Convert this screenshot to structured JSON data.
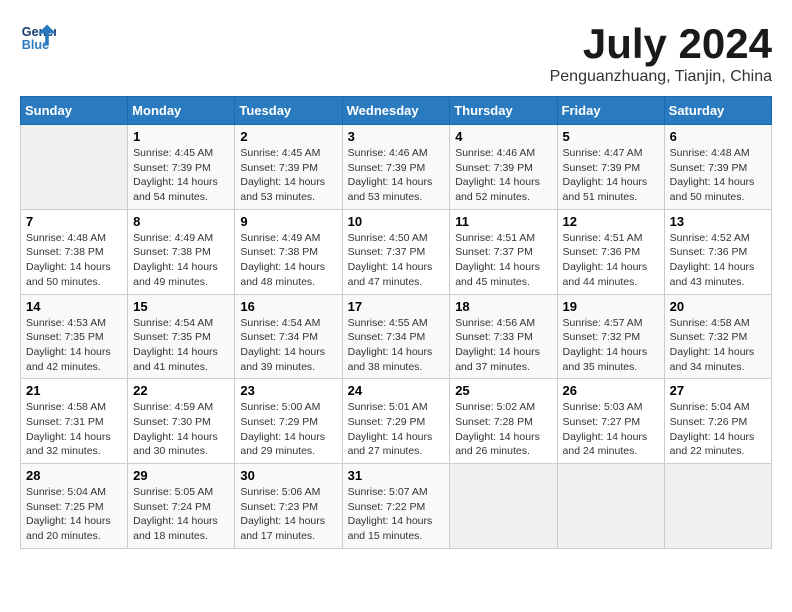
{
  "header": {
    "logo_line1": "General",
    "logo_line2": "Blue",
    "month_year": "July 2024",
    "location": "Penguanzhuang, Tianjin, China"
  },
  "weekdays": [
    "Sunday",
    "Monday",
    "Tuesday",
    "Wednesday",
    "Thursday",
    "Friday",
    "Saturday"
  ],
  "weeks": [
    [
      {
        "day": "",
        "info": ""
      },
      {
        "day": "1",
        "info": "Sunrise: 4:45 AM\nSunset: 7:39 PM\nDaylight: 14 hours\nand 54 minutes."
      },
      {
        "day": "2",
        "info": "Sunrise: 4:45 AM\nSunset: 7:39 PM\nDaylight: 14 hours\nand 53 minutes."
      },
      {
        "day": "3",
        "info": "Sunrise: 4:46 AM\nSunset: 7:39 PM\nDaylight: 14 hours\nand 53 minutes."
      },
      {
        "day": "4",
        "info": "Sunrise: 4:46 AM\nSunset: 7:39 PM\nDaylight: 14 hours\nand 52 minutes."
      },
      {
        "day": "5",
        "info": "Sunrise: 4:47 AM\nSunset: 7:39 PM\nDaylight: 14 hours\nand 51 minutes."
      },
      {
        "day": "6",
        "info": "Sunrise: 4:48 AM\nSunset: 7:39 PM\nDaylight: 14 hours\nand 50 minutes."
      }
    ],
    [
      {
        "day": "7",
        "info": "Sunrise: 4:48 AM\nSunset: 7:38 PM\nDaylight: 14 hours\nand 50 minutes."
      },
      {
        "day": "8",
        "info": "Sunrise: 4:49 AM\nSunset: 7:38 PM\nDaylight: 14 hours\nand 49 minutes."
      },
      {
        "day": "9",
        "info": "Sunrise: 4:49 AM\nSunset: 7:38 PM\nDaylight: 14 hours\nand 48 minutes."
      },
      {
        "day": "10",
        "info": "Sunrise: 4:50 AM\nSunset: 7:37 PM\nDaylight: 14 hours\nand 47 minutes."
      },
      {
        "day": "11",
        "info": "Sunrise: 4:51 AM\nSunset: 7:37 PM\nDaylight: 14 hours\nand 45 minutes."
      },
      {
        "day": "12",
        "info": "Sunrise: 4:51 AM\nSunset: 7:36 PM\nDaylight: 14 hours\nand 44 minutes."
      },
      {
        "day": "13",
        "info": "Sunrise: 4:52 AM\nSunset: 7:36 PM\nDaylight: 14 hours\nand 43 minutes."
      }
    ],
    [
      {
        "day": "14",
        "info": "Sunrise: 4:53 AM\nSunset: 7:35 PM\nDaylight: 14 hours\nand 42 minutes."
      },
      {
        "day": "15",
        "info": "Sunrise: 4:54 AM\nSunset: 7:35 PM\nDaylight: 14 hours\nand 41 minutes."
      },
      {
        "day": "16",
        "info": "Sunrise: 4:54 AM\nSunset: 7:34 PM\nDaylight: 14 hours\nand 39 minutes."
      },
      {
        "day": "17",
        "info": "Sunrise: 4:55 AM\nSunset: 7:34 PM\nDaylight: 14 hours\nand 38 minutes."
      },
      {
        "day": "18",
        "info": "Sunrise: 4:56 AM\nSunset: 7:33 PM\nDaylight: 14 hours\nand 37 minutes."
      },
      {
        "day": "19",
        "info": "Sunrise: 4:57 AM\nSunset: 7:32 PM\nDaylight: 14 hours\nand 35 minutes."
      },
      {
        "day": "20",
        "info": "Sunrise: 4:58 AM\nSunset: 7:32 PM\nDaylight: 14 hours\nand 34 minutes."
      }
    ],
    [
      {
        "day": "21",
        "info": "Sunrise: 4:58 AM\nSunset: 7:31 PM\nDaylight: 14 hours\nand 32 minutes."
      },
      {
        "day": "22",
        "info": "Sunrise: 4:59 AM\nSunset: 7:30 PM\nDaylight: 14 hours\nand 30 minutes."
      },
      {
        "day": "23",
        "info": "Sunrise: 5:00 AM\nSunset: 7:29 PM\nDaylight: 14 hours\nand 29 minutes."
      },
      {
        "day": "24",
        "info": "Sunrise: 5:01 AM\nSunset: 7:29 PM\nDaylight: 14 hours\nand 27 minutes."
      },
      {
        "day": "25",
        "info": "Sunrise: 5:02 AM\nSunset: 7:28 PM\nDaylight: 14 hours\nand 26 minutes."
      },
      {
        "day": "26",
        "info": "Sunrise: 5:03 AM\nSunset: 7:27 PM\nDaylight: 14 hours\nand 24 minutes."
      },
      {
        "day": "27",
        "info": "Sunrise: 5:04 AM\nSunset: 7:26 PM\nDaylight: 14 hours\nand 22 minutes."
      }
    ],
    [
      {
        "day": "28",
        "info": "Sunrise: 5:04 AM\nSunset: 7:25 PM\nDaylight: 14 hours\nand 20 minutes."
      },
      {
        "day": "29",
        "info": "Sunrise: 5:05 AM\nSunset: 7:24 PM\nDaylight: 14 hours\nand 18 minutes."
      },
      {
        "day": "30",
        "info": "Sunrise: 5:06 AM\nSunset: 7:23 PM\nDaylight: 14 hours\nand 17 minutes."
      },
      {
        "day": "31",
        "info": "Sunrise: 5:07 AM\nSunset: 7:22 PM\nDaylight: 14 hours\nand 15 minutes."
      },
      {
        "day": "",
        "info": ""
      },
      {
        "day": "",
        "info": ""
      },
      {
        "day": "",
        "info": ""
      }
    ]
  ]
}
